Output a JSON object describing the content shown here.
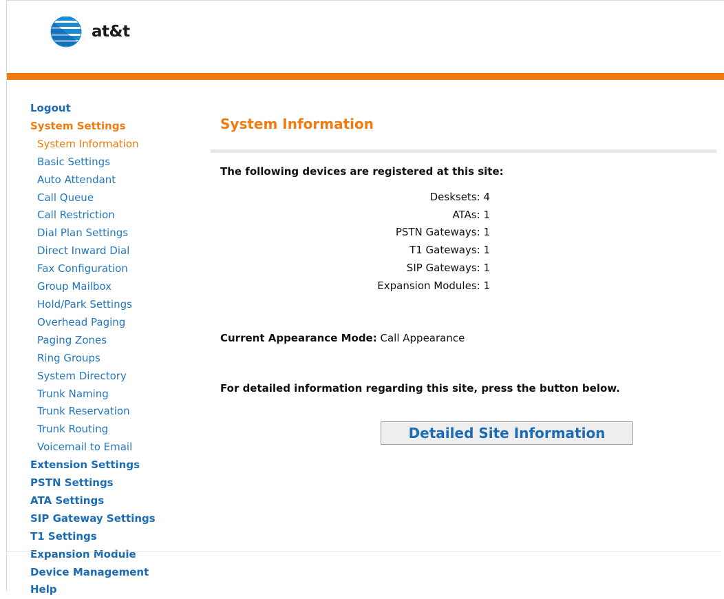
{
  "brand": {
    "logo_text": "at&t",
    "colors": {
      "accent": "#f07b10",
      "link": "#1b6cb3",
      "globe_blue": "#1a8ad2"
    }
  },
  "sidebar": {
    "logout": "Logout",
    "system_settings": {
      "label": "System Settings",
      "items": [
        "System Information",
        "Basic Settings",
        "Auto Attendant",
        "Call Queue",
        "Call Restriction",
        "Dial Plan Settings",
        "Direct Inward Dial",
        "Fax Configuration",
        "Group Mailbox",
        "Hold/Park Settings",
        "Overhead Paging",
        "Paging Zones",
        "Ring Groups",
        "System Directory",
        "Trunk Naming",
        "Trunk Reservation",
        "Trunk Routing",
        "Voicemail to Email"
      ]
    },
    "sections": [
      "Extension Settings",
      "PSTN Settings",
      "ATA Settings",
      "SIP Gateway Settings",
      "T1 Settings",
      "Expansion Module",
      "Device Management",
      "Help"
    ]
  },
  "main": {
    "title": "System Information",
    "registered_heading": "The following devices are registered at this site:",
    "devices": [
      "Desksets: 4",
      "ATAs: 1",
      "PSTN Gateways: 1",
      "T1 Gateways: 1",
      "SIP Gateways: 1",
      "Expansion Modules: 1"
    ],
    "appearance_label": "Current Appearance Mode:",
    "appearance_value": " Call Appearance",
    "detail_hint": "For detailed information regarding this site, press the button below.",
    "detail_button": "Detailed Site Information"
  }
}
